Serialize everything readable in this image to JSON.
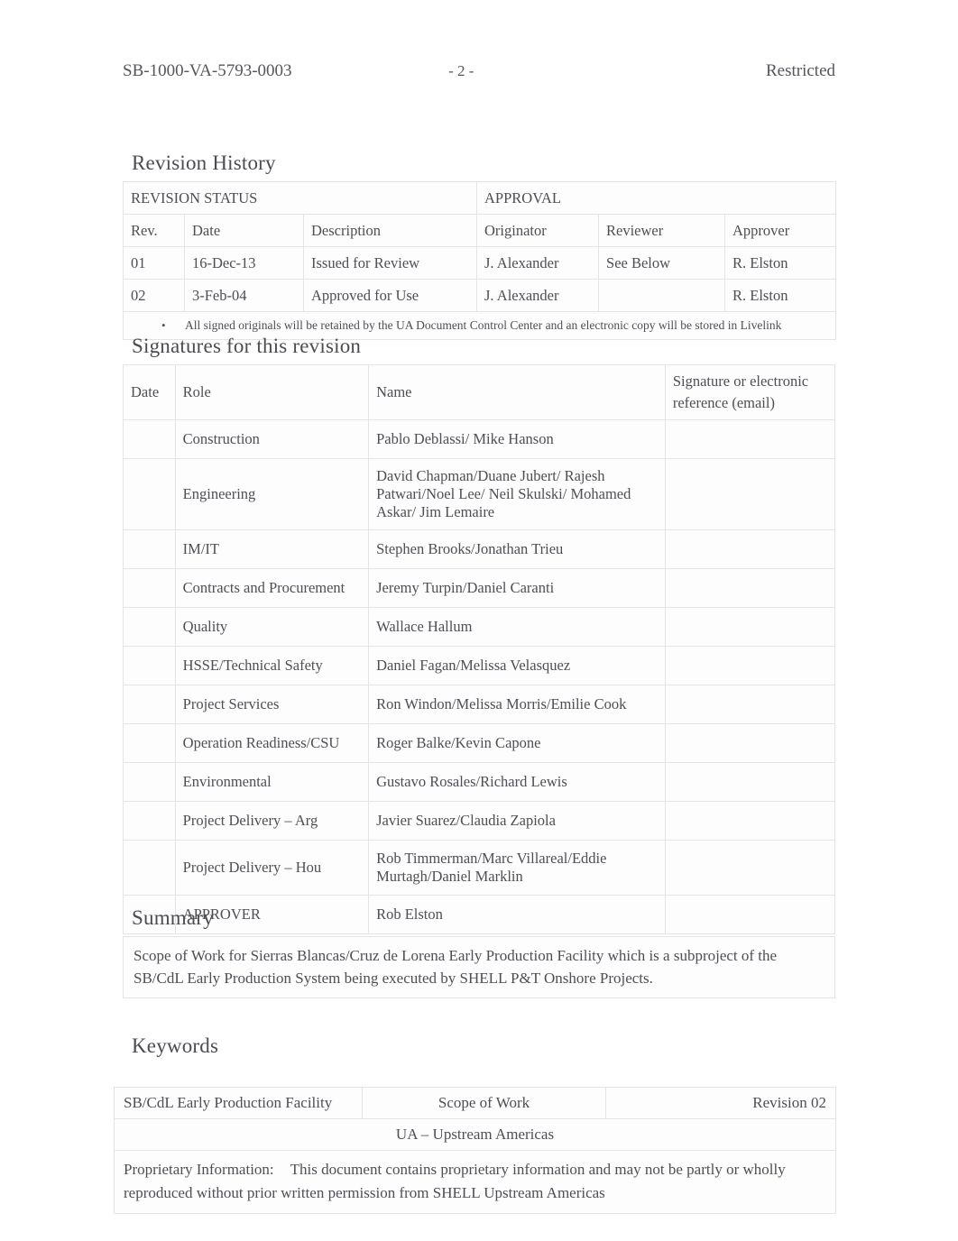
{
  "header": {
    "document_number": "SB-1000-VA-5793-0003",
    "page_marker": "- 2 -",
    "classification": "Restricted"
  },
  "revision_history": {
    "heading": "Revision History",
    "group_headers": {
      "status": "REVISION STATUS",
      "approval": "APPROVAL"
    },
    "columns": [
      "Rev.",
      "Date",
      "Description",
      "Originator",
      "Reviewer",
      "Approver"
    ],
    "rows": [
      {
        "rev": "01",
        "date": "16-Dec-13",
        "description": "Issued for Review",
        "originator": "J. Alexander",
        "reviewer": "See Below",
        "approver": "R. Elston"
      },
      {
        "rev": "02",
        "date": "3-Feb-04",
        "description": "Approved for Use",
        "originator": "J. Alexander",
        "reviewer": "",
        "approver": "R. Elston"
      }
    ],
    "note_bullet": "•",
    "note": "All signed originals will be retained by the UA Document Control Center and an electronic copy will be stored in Livelink"
  },
  "signatures": {
    "heading": "Signatures for this revision",
    "columns": {
      "date": "Date",
      "role": "Role",
      "name": "Name",
      "signature": "Signature or electronic reference (email)"
    },
    "rows": [
      {
        "date": "",
        "role": "Construction",
        "name": "Pablo Deblassi/ Mike Hanson",
        "signature": ""
      },
      {
        "date": "",
        "role": "Engineering",
        "name": "David Chapman/Duane Jubert/ Rajesh Patwari/Noel Lee/ Neil Skulski/ Mohamed Askar/ Jim Lemaire",
        "signature": ""
      },
      {
        "date": "",
        "role": "IM/IT",
        "name": "Stephen Brooks/Jonathan Trieu",
        "signature": ""
      },
      {
        "date": "",
        "role": "Contracts and Procurement",
        "name": "Jeremy Turpin/Daniel Caranti",
        "signature": ""
      },
      {
        "date": "",
        "role": "Quality",
        "name": "Wallace Hallum",
        "signature": ""
      },
      {
        "date": "",
        "role": "HSSE/Technical Safety",
        "name": "Daniel Fagan/Melissa Velasquez",
        "signature": ""
      },
      {
        "date": "",
        "role": "Project Services",
        "name": "Ron Windon/Melissa Morris/Emilie Cook",
        "signature": ""
      },
      {
        "date": "",
        "role": "Operation Readiness/CSU",
        "name": "Roger Balke/Kevin Capone",
        "signature": ""
      },
      {
        "date": "",
        "role": "Environmental",
        "name": "Gustavo Rosales/Richard Lewis",
        "signature": ""
      },
      {
        "date": "",
        "role": "Project Delivery – Arg",
        "name": "Javier Suarez/Claudia Zapiola",
        "signature": ""
      },
      {
        "date": "",
        "role": "Project Delivery – Hou",
        "name": "Rob Timmerman/Marc Villareal/Eddie Murtagh/Daniel Marklin",
        "signature": ""
      },
      {
        "date": "",
        "role": "APPROVER",
        "name": "Rob Elston",
        "signature": ""
      }
    ]
  },
  "summary": {
    "heading": "Summary",
    "text": "Scope of Work for Sierras Blancas/Cruz de Lorena Early Production Facility which is a subproject of the SB/CdL Early Production System being executed by SHELL P&T Onshore Projects."
  },
  "keywords": {
    "heading": "Keywords",
    "facility": "SB/CdL Early Production Facility",
    "scope": "Scope of Work",
    "revision": "Revision  02",
    "business_unit": "UA – Upstream Americas",
    "proprietary_label": "Proprietary Information:",
    "proprietary_text": "This document contains proprietary information and may not be partly or wholly reproduced without prior written permission from SHELL Upstream Americas"
  }
}
